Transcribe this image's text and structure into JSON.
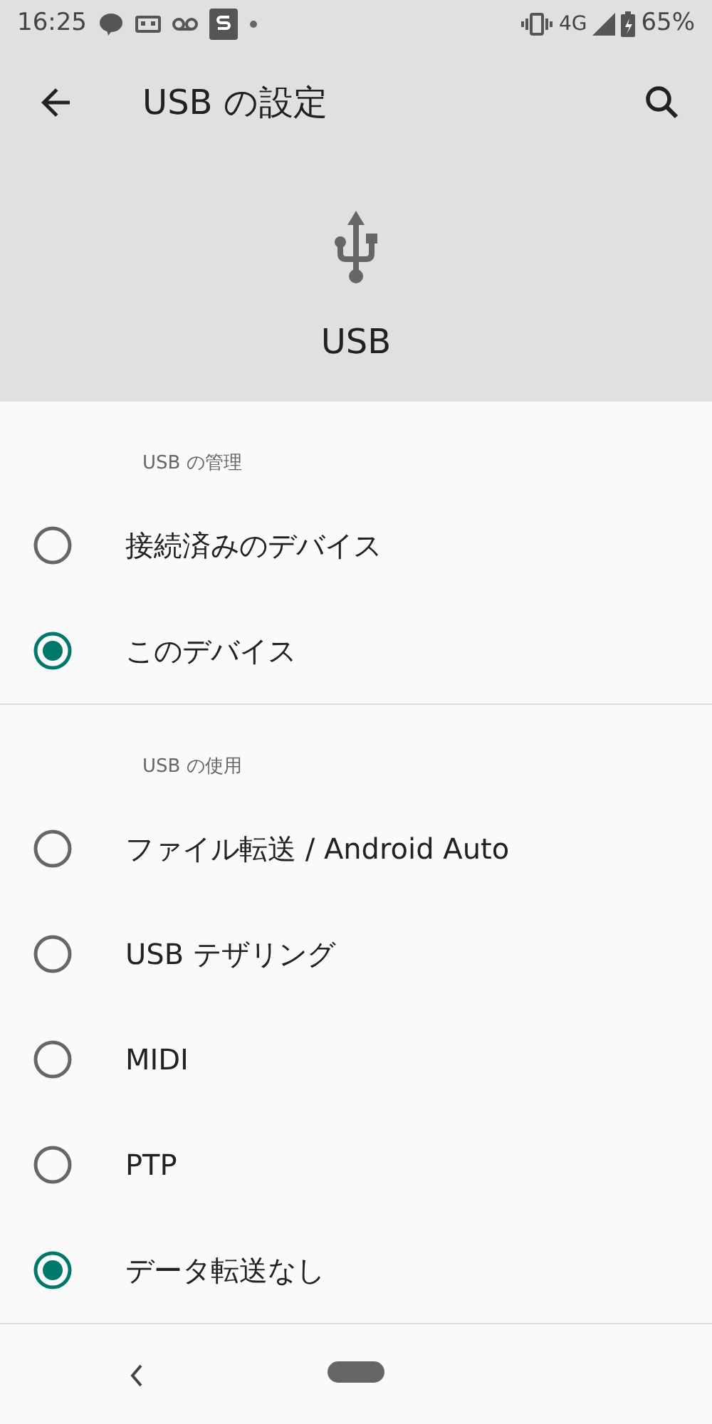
{
  "status_bar": {
    "time": "16:25",
    "network": "4G",
    "battery": "65%"
  },
  "app_bar": {
    "title": "USB の設定"
  },
  "header": {
    "label": "USB"
  },
  "sections": [
    {
      "title": "USB の管理",
      "options": [
        {
          "label": "接続済みのデバイス",
          "selected": false
        },
        {
          "label": "このデバイス",
          "selected": true
        }
      ]
    },
    {
      "title": "USB の使用",
      "options": [
        {
          "label": "ファイル転送 / Android Auto",
          "selected": false
        },
        {
          "label": "USB テザリング",
          "selected": false
        },
        {
          "label": "MIDI",
          "selected": false
        },
        {
          "label": "PTP",
          "selected": false
        },
        {
          "label": "データ転送なし",
          "selected": true
        }
      ]
    }
  ]
}
